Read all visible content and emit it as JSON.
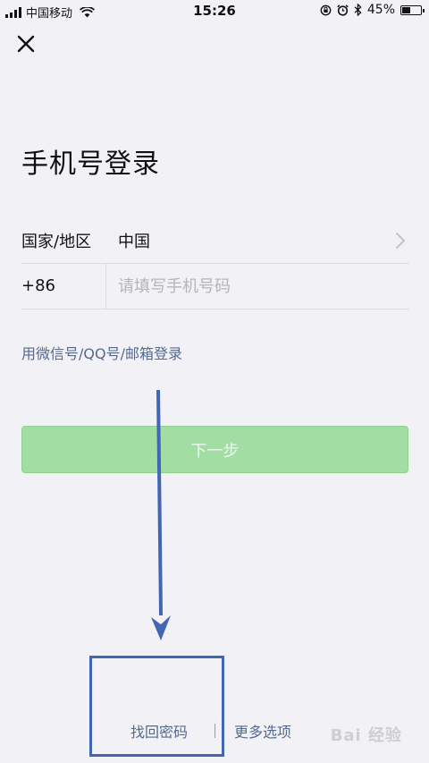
{
  "status_bar": {
    "carrier": "中国移动",
    "time": "15:26",
    "battery_percent_text": "45%",
    "battery_level": 0.45
  },
  "title": "手机号登录",
  "region": {
    "label": "国家/地区",
    "value": "中国"
  },
  "phone": {
    "country_code": "+86",
    "placeholder": "请填写手机号码",
    "value": ""
  },
  "alt_login_label": "用微信号/QQ号/邮箱登录",
  "next_button_label": "下一步",
  "bottom_links": {
    "recover_password": "找回密码",
    "more_options": "更多选项"
  },
  "watermark": "Bai 经验",
  "colors": {
    "background": "#f2f1f6",
    "link": "#556a8e",
    "button_disabled": "#a2dea4",
    "annotation": "#4366b4"
  },
  "icons": {
    "close": "close-icon",
    "chevron": "chevron-right-icon",
    "wifi": "wifi-icon",
    "alarm": "alarm-icon",
    "bluetooth": "bluetooth-icon",
    "lock_rotation": "rotation-lock-icon"
  }
}
